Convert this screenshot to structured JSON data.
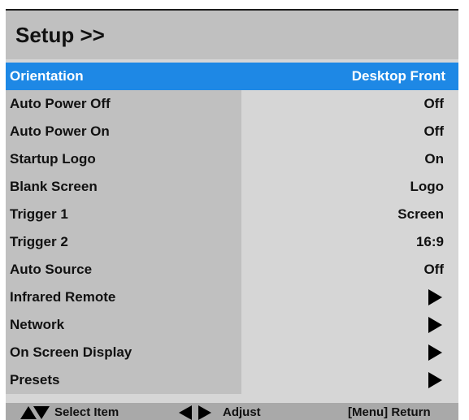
{
  "header": {
    "title": "Setup >>"
  },
  "colors": {
    "accent": "#1e88e5",
    "header_bg": "#c0c0c0",
    "label_bg": "#c0c0c0",
    "value_bg": "#d6d6d6",
    "footer_bg": "#a9a9a9"
  },
  "menu": {
    "selected_index": 0,
    "items": [
      {
        "label": "Orientation",
        "value": "Desktop Front"
      },
      {
        "label": "Auto Power Off",
        "value": "Off"
      },
      {
        "label": "Auto Power On",
        "value": "Off"
      },
      {
        "label": "Startup Logo",
        "value": "On"
      },
      {
        "label": "Blank Screen",
        "value": "Logo"
      },
      {
        "label": "Trigger 1",
        "value": "Screen"
      },
      {
        "label": "Trigger 2",
        "value": "16:9"
      },
      {
        "label": "Auto Source",
        "value": "Off"
      },
      {
        "label": "Infrared Remote",
        "icon": "submenu-arrow-icon"
      },
      {
        "label": "Network",
        "icon": "submenu-arrow-icon"
      },
      {
        "label": "On Screen Display",
        "icon": "submenu-arrow-icon"
      },
      {
        "label": "Presets",
        "icon": "submenu-arrow-icon"
      }
    ]
  },
  "footer": {
    "select_hint": "Select Item",
    "adjust_hint": "Adjust",
    "return_hint": "[Menu] Return"
  }
}
